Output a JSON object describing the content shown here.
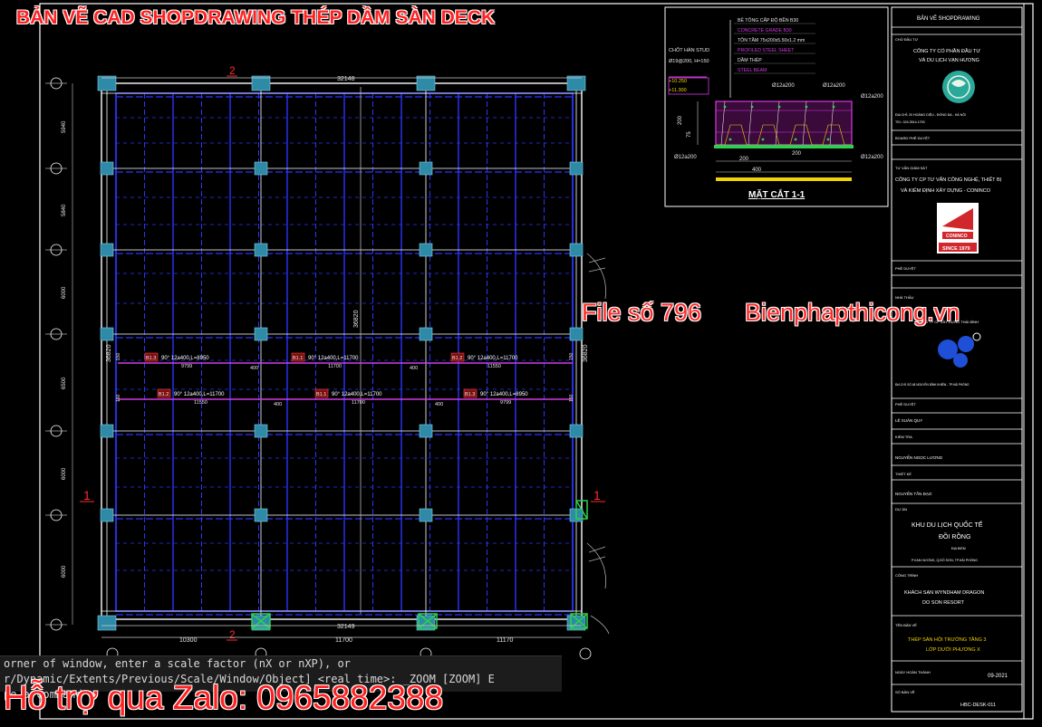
{
  "banners": {
    "title": "BẢN VẼ CAD SHOPDRAWING THÉP DẦM SÀN DECK",
    "file": "File số 796",
    "site": "Bienphapthicong.vn",
    "zalo": "Hỗ trợ qua Zalo: 0965882388"
  },
  "command_line": {
    "line1": "orner of window, enter a scale factor (nX or nXP), or",
    "line2": "r/Dynamic/Extents/Previous/Scale/Window/Object] <real time>: _ZOOM [ZOOM] E",
    "line3": "pe a command"
  },
  "plan": {
    "section_marker_top": "2",
    "section_marker_bottom": "2",
    "section_marker_left": "1",
    "section_marker_right": "1",
    "dim_top": "32148",
    "dim_bottom": "32149",
    "dim_bottom_segments": [
      "10300",
      "11700",
      "11170"
    ],
    "dim_center_vertical": "36820",
    "dim_left_vertical": "36820",
    "dim_right_vertical": "36820",
    "left_dims": [
      "5940",
      "5840",
      "6000",
      "6500",
      "6000",
      "6000"
    ],
    "top_grid_labels": [
      "",
      "",
      "",
      ""
    ],
    "grid_row_labels": [
      "",
      "",
      "",
      "",
      "",
      ""
    ],
    "beam_row1": [
      {
        "tag": "B1.3",
        "spec": "90° 12a400,L=8950",
        "len": "9799"
      },
      {
        "tag": "B1.1",
        "spec": "90° 12a400,L=11700",
        "len": "11700"
      },
      {
        "tag": "B1.2",
        "spec": "90° 12a400,L=11700",
        "len": "11550"
      }
    ],
    "beam_row2": [
      {
        "tag": "B1.2",
        "spec": "90° 12a400,L=11700",
        "len": "11550"
      },
      {
        "tag": "B1.1",
        "spec": "90° 12a400,L=11700",
        "len": "11700"
      },
      {
        "tag": "B1.3",
        "spec": "90° 12a400,L=8950",
        "len": "9799"
      }
    ],
    "small_dims": [
      "400",
      "400",
      "400",
      "400",
      "150",
      "150"
    ]
  },
  "section": {
    "note_lines": [
      "BÊ TÔNG CẤP ĐỘ BỀN B30",
      "CONCRETE GRADE B30",
      "TÔN TẦM 75x200x5.50x1.2 mm",
      "PROFILED STEEL SHEET",
      "DẦM THÉP",
      "STEEL BEAM"
    ],
    "stud": "CHỐT HÀN STUD",
    "stud2": "Ø19@200, H=150",
    "level1": "+10.250",
    "level2": "+11.300",
    "rebar_top1": "Ø12a200",
    "rebar_top2": "Ø12a200",
    "rebar_right": "Ø12a200",
    "rebar_right2": "Ø12a200",
    "rebar_bottom_left": "Ø12a200",
    "dim_200": "200",
    "dim_75": "75",
    "dim_b1": "200",
    "dim_b2": "200",
    "dim_b3": "400",
    "title": "MẶT CẮT 1-1"
  },
  "titleblock": {
    "header": "BẢN VẼ SHOPDRAWING",
    "owner_label": "CHỦ ĐẦU TƯ",
    "owner_name1": "CÔNG TY CỔ PHẦN ĐẦU TƯ",
    "owner_name2": "VÀ DU LỊCH VẠN HƯƠNG",
    "owner_addr1": "ĐỊA CHỈ: 20 HOÀNG DIỆU - ĐỐNG ĐA - HÀ NỘI",
    "owner_addr2": "TEL: 024.3514.1700",
    "approve1": "BOARD PHÊ DUYỆT",
    "consult_label": "TƯ VẤN GIÁM SÁT",
    "consult_name1": "CÔNG TY CP TƯ VẤN CÔNG NGHỆ, THIẾT BỊ",
    "consult_name2": "VÀ KIỂM ĐỊNH XÂY DỰNG - CONINCO",
    "coninco": "CONINCO",
    "since": "SINCE 1979",
    "approve2": "PHÊ DUYỆT",
    "contractor_label": "NHÀ THẦU",
    "contractor_name": "CÔNG TY CP XÂY DỰNG THÁI BÌNH",
    "contractor_addr": "ĐỊA CHỈ: SỐ 48 NGUYỄN BỈNH KHIÊM - TP.HẢI PHÒNG",
    "approve3": "PHÊ DUYỆT",
    "approver": "LÊ XUÂN QUY",
    "check_label": "KIỂM TRA",
    "checker": "NGUYỄN NGỌC LƯƠNG",
    "draw_label": "THIẾT KẾ",
    "drawer": "NGUYỄN TẤN ĐẠO",
    "project_label": "DỰ ÁN",
    "project1": "KHU DU LỊCH QUỐC TẾ",
    "project2": "ĐỒI RỒNG",
    "project_addr_label": "ĐỊA ĐIỂM",
    "project_addr": "P.VẠN HƯƠNG, Q.ĐỒ SƠN, TP.HẢI PHÒNG",
    "work_label": "CÔNG TRÌNH",
    "work1": "KHÁCH SẠN WYNDHAM DRAGON",
    "work2": "DO SON RESORT",
    "sheet_label": "TÊN BẢN VẼ",
    "sheet1": "THÉP SÀN HỘI TRƯỜNG TẦNG 3",
    "sheet2": "LỚP DƯỚI PHƯƠNG X",
    "date_label": "NGÀY HOÀN THÀNH",
    "date": "09-2021",
    "number_label": "SỐ BẢN VẼ",
    "number": "HBC-DESK-011"
  },
  "colors": {
    "background": "#000000",
    "grid_line": "#ffffff",
    "beam_blue": "#2b34ff",
    "beam_magenta": "#d23be2",
    "column_cyan": "#2f8aa8",
    "dim_text": "#e6e6e6",
    "red_marker": "#ff2b2b",
    "green_bracing": "#2bd24b",
    "yellow": "#f2d200"
  }
}
